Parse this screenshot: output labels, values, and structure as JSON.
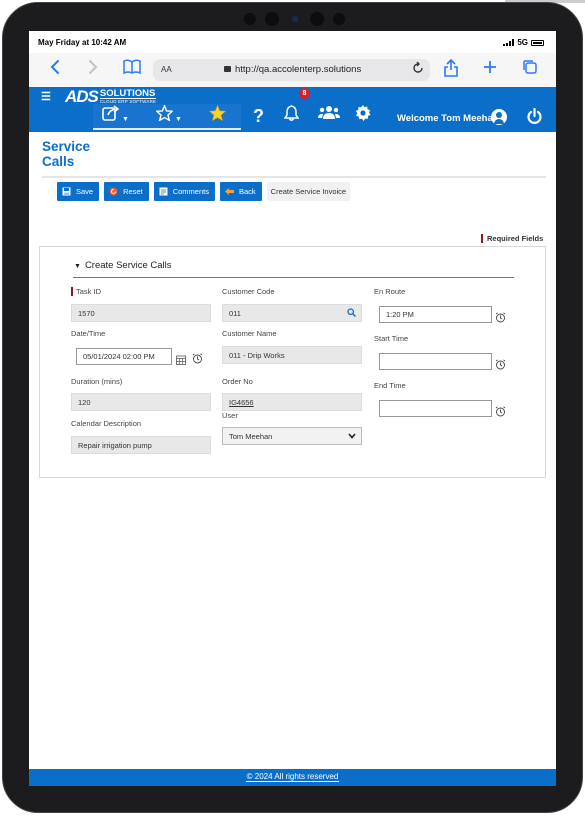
{
  "status_bar": {
    "time": "May Friday at 10:42 AM",
    "network": "5G"
  },
  "browser": {
    "text_size_label": "AA",
    "url": "http://qa.accolenterp.solutions"
  },
  "app": {
    "brand_mark": "ADS",
    "brand_name": "SOLUTIONS",
    "brand_tagline": "CLOUD ERP SOFTWARE",
    "notification_count": "8",
    "welcome_text": "Welcome Tom Meehan",
    "accent_color": "#0b6fc9",
    "icons": [
      "menu-icon",
      "share-icon",
      "star-outline-icon",
      "star-filled-icon",
      "help-icon",
      "bell-icon",
      "users-icon",
      "gear-icon",
      "user-icon",
      "power-icon"
    ]
  },
  "page": {
    "title": "Service Calls",
    "actions": {
      "save": "Save",
      "reset": "Reset",
      "comments": "Comments",
      "back": "Back",
      "create_invoice": "Create Service Invoice"
    },
    "required_fields": "Required Fields",
    "section_title": "Create Service Calls"
  },
  "form": {
    "task_id": {
      "label": "Task ID",
      "value": "1570"
    },
    "date_time": {
      "label": "Date/Time",
      "value": "05/01/2024 02:00 PM"
    },
    "duration": {
      "label": "Duration (mins)",
      "value": "120"
    },
    "calendar_description": {
      "label": "Calendar Description",
      "value": "Repair irrigation pump"
    },
    "customer_code": {
      "label": "Customer Code",
      "value": "011"
    },
    "customer_name": {
      "label": "Customer Name",
      "value": "011 - Drip Works"
    },
    "order_no": {
      "label": "Order No",
      "value": "IG4656"
    },
    "user": {
      "label": "User",
      "value": "Tom Meehan"
    },
    "en_route": {
      "label": "En Route",
      "value": "1:20 PM"
    },
    "start_time": {
      "label": "Start Time",
      "value": ""
    },
    "end_time": {
      "label": "End Time",
      "value": ""
    }
  },
  "footer": {
    "copyright": "© 2024 All rights reserved"
  }
}
